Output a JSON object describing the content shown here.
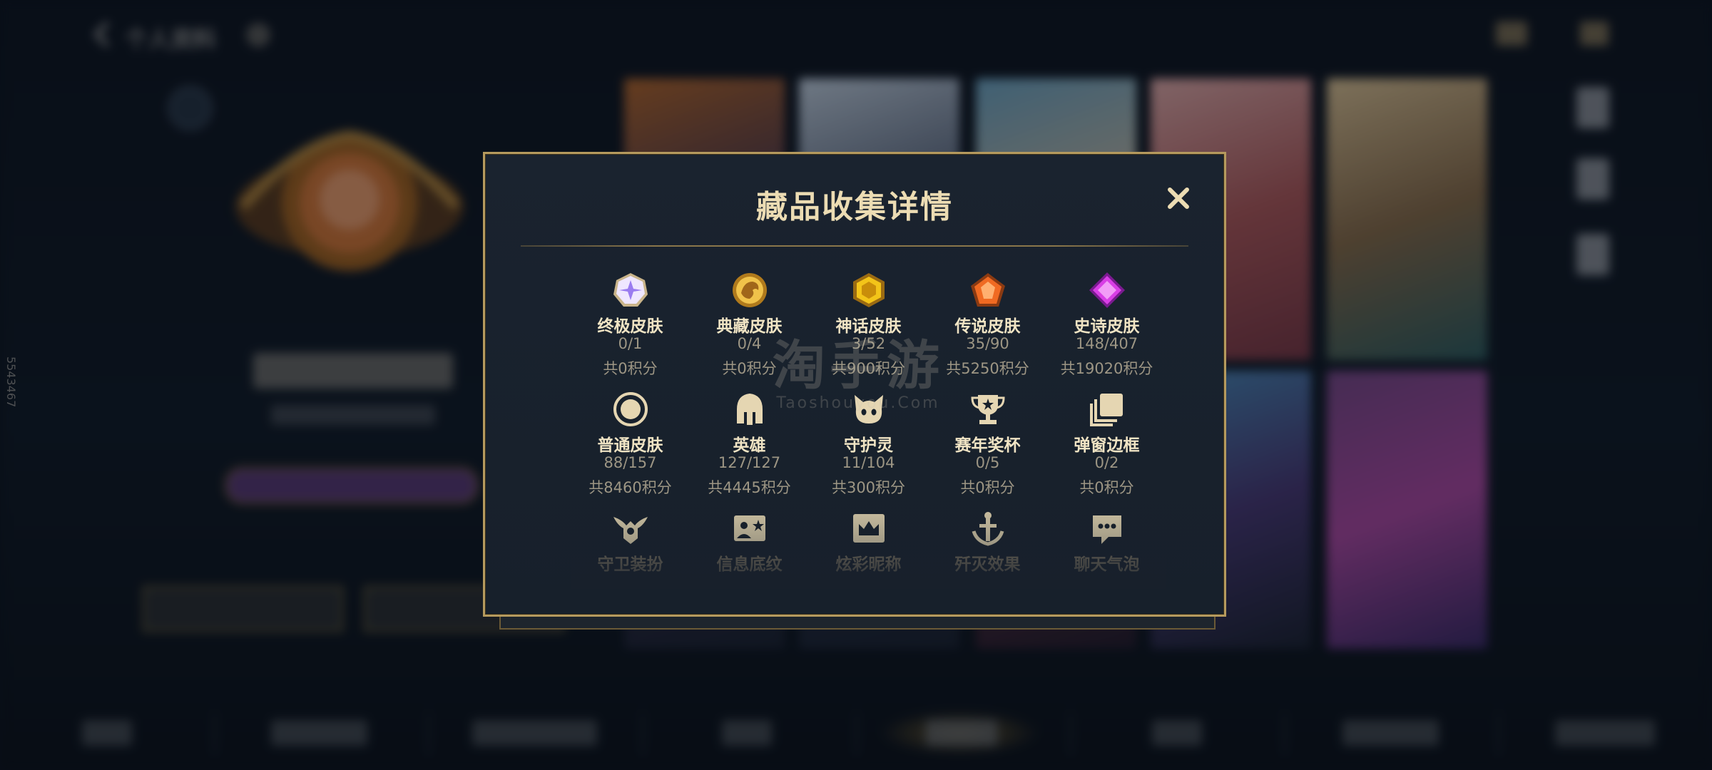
{
  "background": {
    "header_title": "个人资料",
    "side_id": "5543467"
  },
  "dialog": {
    "title": "藏品收集详情",
    "close_label": "✕",
    "categories": [
      {
        "name": "终极皮肤",
        "count": "0/1",
        "points": "共0积分",
        "icon": "ultimate-skin-icon"
      },
      {
        "name": "典藏皮肤",
        "count": "0/4",
        "points": "共0积分",
        "icon": "collection-skin-icon"
      },
      {
        "name": "神话皮肤",
        "count": "3/52",
        "points": "共900积分",
        "icon": "mythic-skin-icon"
      },
      {
        "name": "传说皮肤",
        "count": "35/90",
        "points": "共5250积分",
        "icon": "legendary-skin-icon"
      },
      {
        "name": "史诗皮肤",
        "count": "148/407",
        "points": "共19020积分",
        "icon": "epic-skin-icon"
      },
      {
        "name": "普通皮肤",
        "count": "88/157",
        "points": "共8460积分",
        "icon": "normal-skin-icon"
      },
      {
        "name": "英雄",
        "count": "127/127",
        "points": "共4445积分",
        "icon": "hero-helmet-icon"
      },
      {
        "name": "守护灵",
        "count": "11/104",
        "points": "共300积分",
        "icon": "guardian-spirit-icon"
      },
      {
        "name": "赛年奖杯",
        "count": "0/5",
        "points": "共0积分",
        "icon": "season-trophy-icon"
      },
      {
        "name": "弹窗边框",
        "count": "0/2",
        "points": "共0积分",
        "icon": "popup-frame-icon"
      },
      {
        "name": "守卫装扮",
        "icon": "guard-outfit-icon"
      },
      {
        "name": "信息底纹",
        "icon": "info-pattern-icon"
      },
      {
        "name": "炫彩昵称",
        "icon": "colorful-nickname-icon"
      },
      {
        "name": "歼灭效果",
        "icon": "annihilation-effect-icon"
      },
      {
        "name": "聊天气泡",
        "icon": "chat-bubble-icon"
      }
    ]
  },
  "watermark": {
    "main": "淘手游",
    "sub": "Taoshouyou.Com"
  },
  "colors": {
    "dialog_border": "#b59a5e",
    "title": "#ecdcb3",
    "label": "#f0e4c4",
    "muted": "#9d9684"
  }
}
